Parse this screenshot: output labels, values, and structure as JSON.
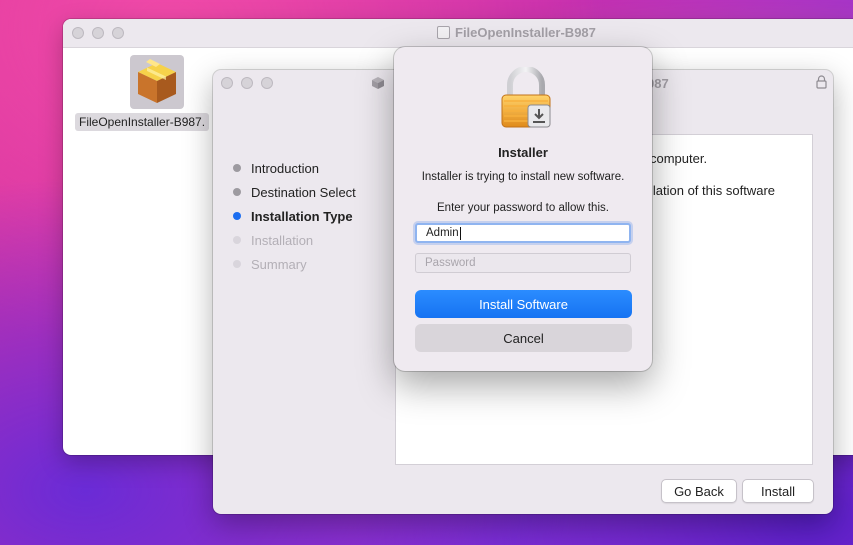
{
  "finder_window": {
    "title": "FileOpenInstaller-B987",
    "file_label": "FileOpenInstaller-B987."
  },
  "installer_window": {
    "title_fragment": "987",
    "steps": [
      {
        "label": "Introduction",
        "state": "done"
      },
      {
        "label": "Destination Select",
        "state": "done"
      },
      {
        "label": "Installation Type",
        "state": "active"
      },
      {
        "label": "Installation",
        "state": "todo"
      },
      {
        "label": "Summary",
        "state": "todo"
      }
    ],
    "content_line1": "computer.",
    "content_line2": "llation of this software",
    "go_back_label": "Go Back",
    "install_label": "Install"
  },
  "auth_dialog": {
    "title": "Installer",
    "message": "Installer is trying to install new software.",
    "prompt": "Enter your password to allow this.",
    "username_value": "Admin",
    "password_placeholder": "Password",
    "install_button": "Install Software",
    "cancel_button": "Cancel"
  },
  "colors": {
    "accent": "#1b6df0",
    "button_blue": "#1673f2"
  }
}
